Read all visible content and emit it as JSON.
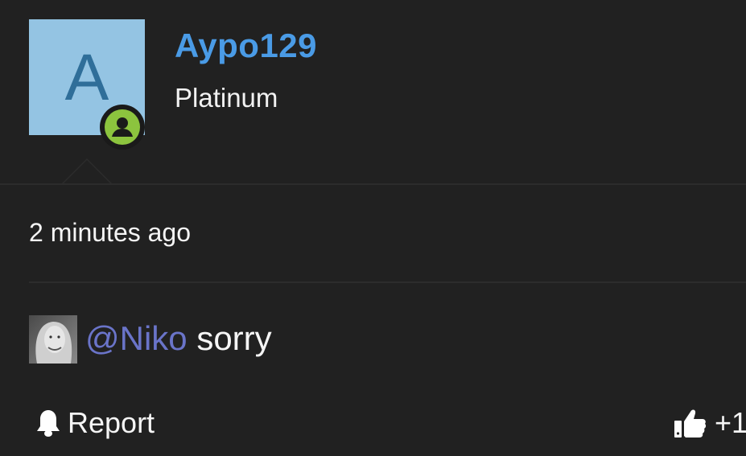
{
  "user": {
    "avatar_letter": "A",
    "username": "Aypo129",
    "rank": "Platinum",
    "avatar_color": "#94c4e3",
    "status_icon": "user-online-icon",
    "status_color": "#8cc43e"
  },
  "post": {
    "timestamp": "2 minutes ago",
    "mention": "@Niko",
    "text": "sorry"
  },
  "actions": {
    "report_label": "Report",
    "like_count": "+1"
  },
  "colors": {
    "username": "#4a9be6",
    "mention": "#6a74c9",
    "background": "#212121"
  }
}
